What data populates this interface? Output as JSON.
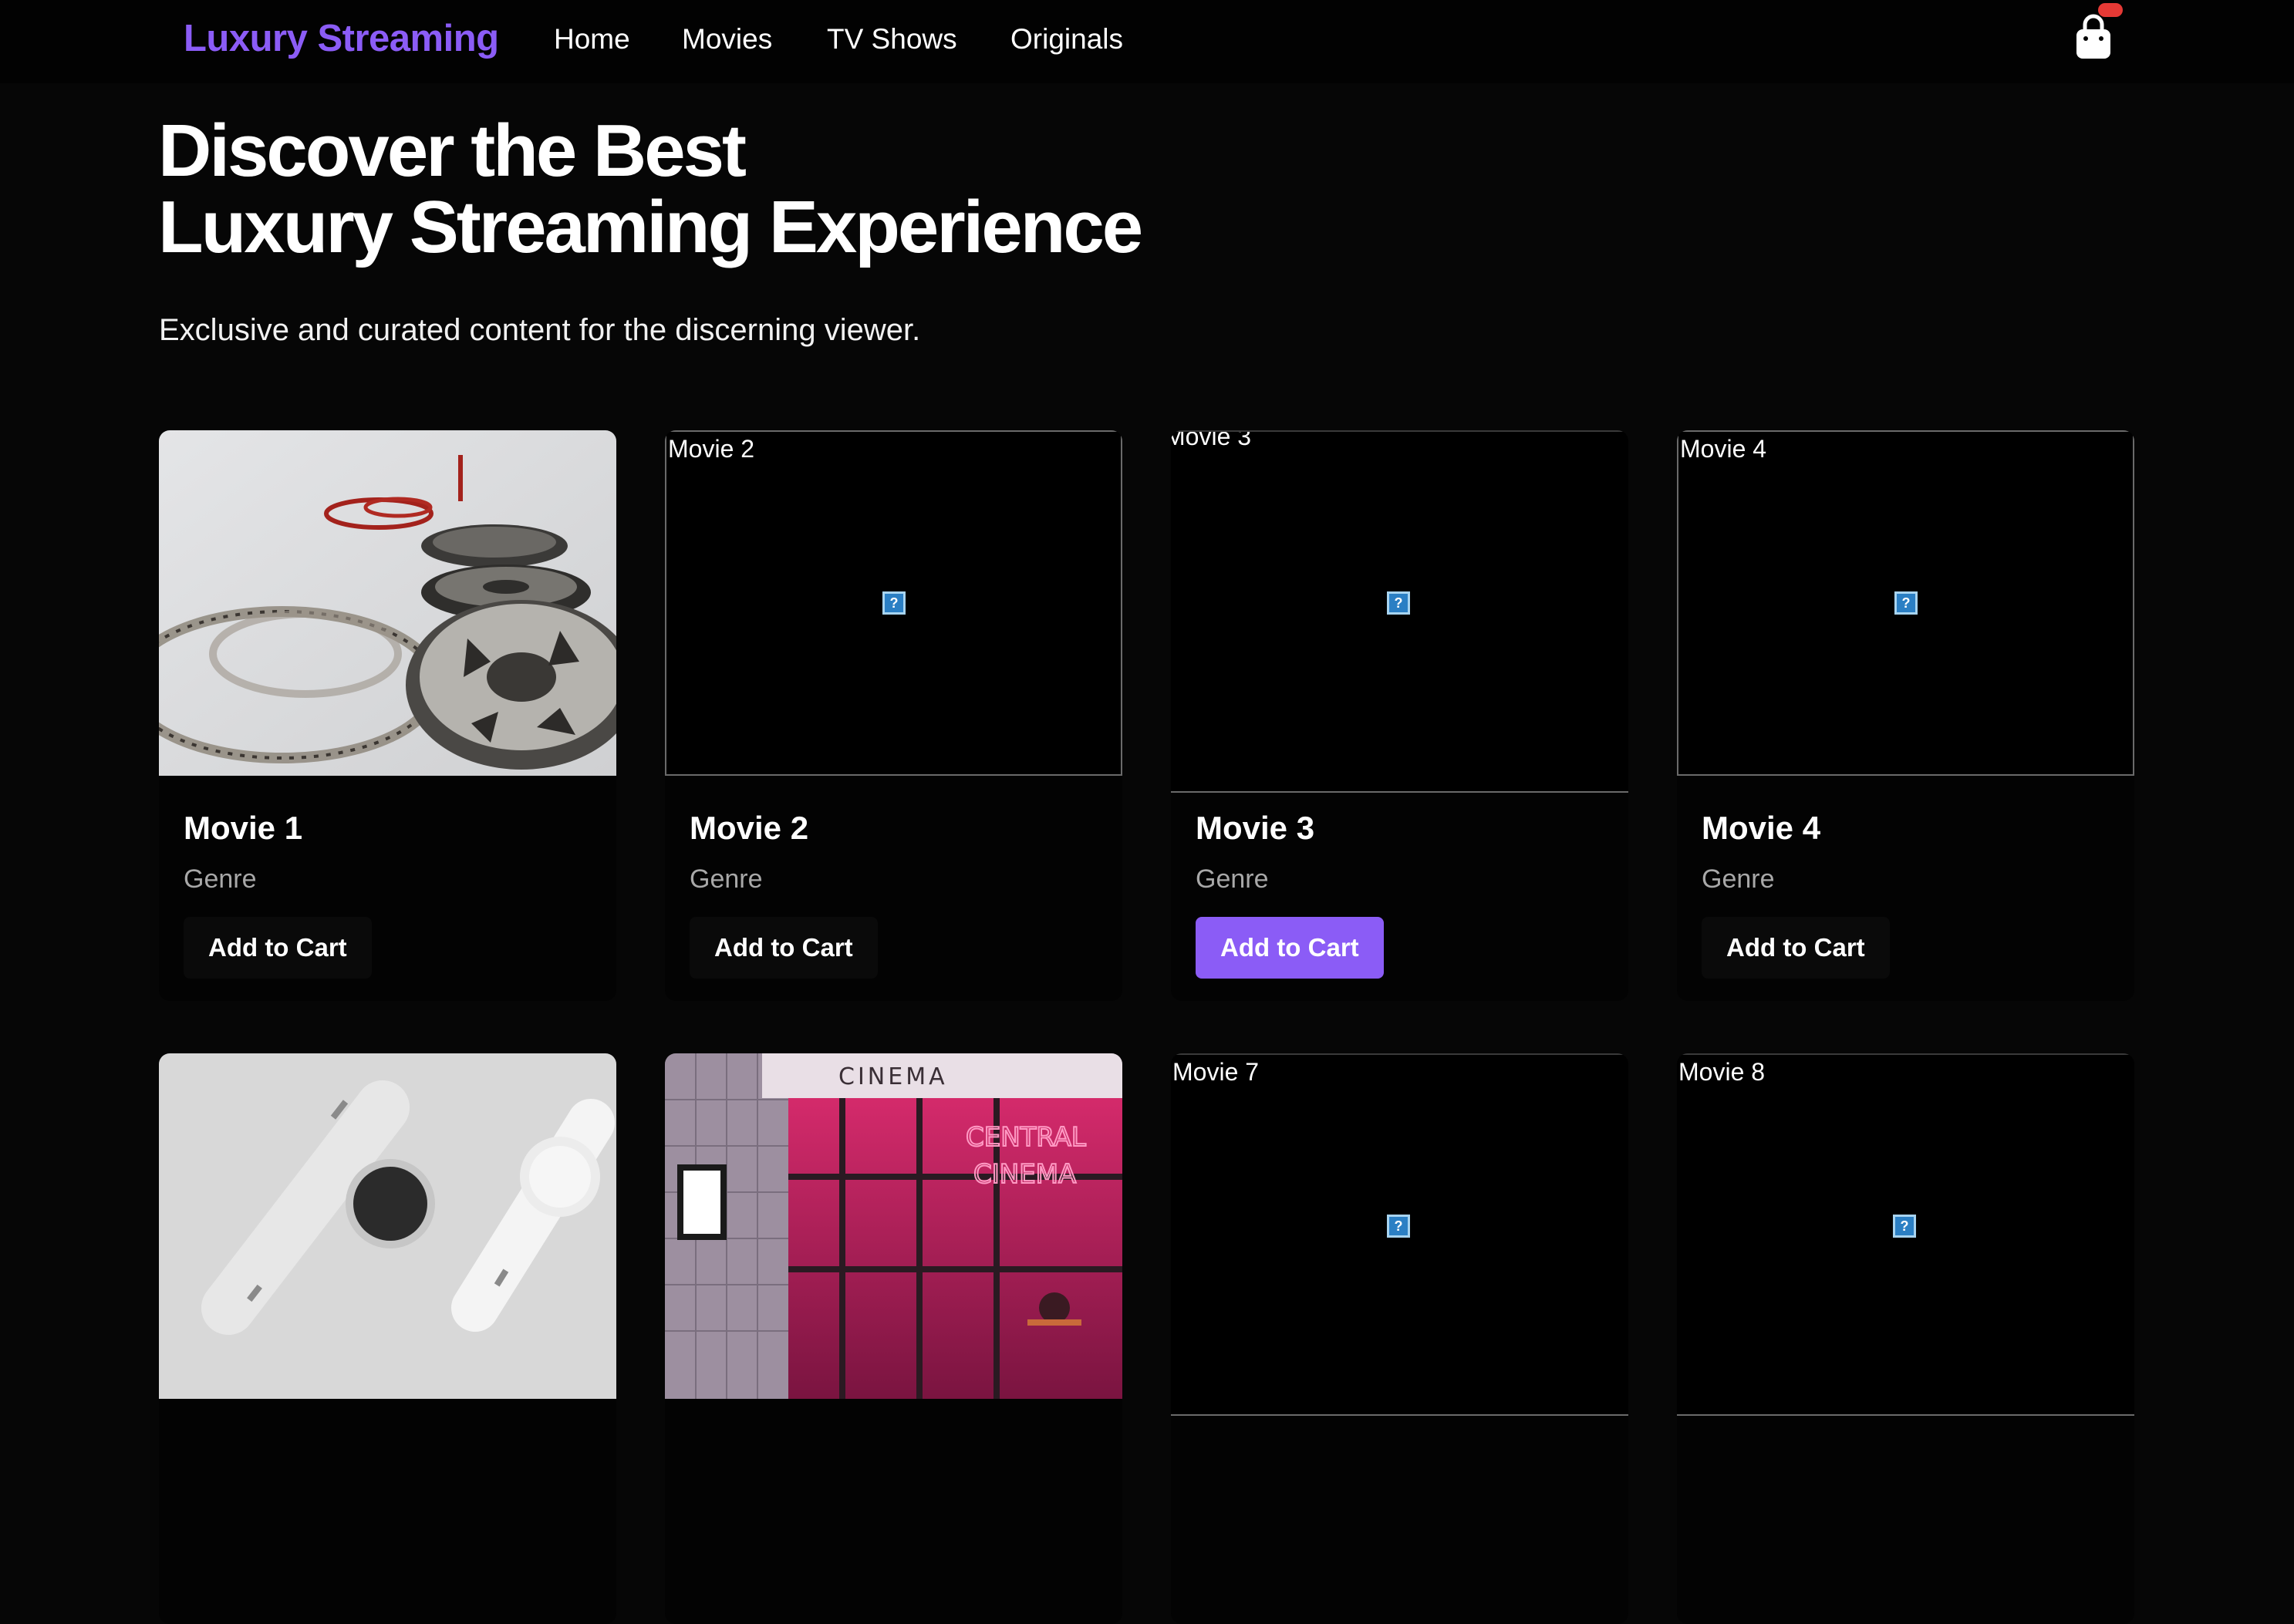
{
  "nav": {
    "brand": "Luxury Streaming",
    "links": [
      "Home",
      "Movies",
      "TV Shows",
      "Originals"
    ],
    "cart_icon": "shopping-bag-icon",
    "badge_color": "#e53935"
  },
  "hero": {
    "title_line1": "Discover the Best",
    "title_line2": "Luxury Streaming Experience",
    "subtitle": "Exclusive and curated content for the discerning viewer."
  },
  "colors": {
    "accent": "#8b5cf6",
    "background": "#060606",
    "genre_text": "#a8a8a8"
  },
  "movies": [
    {
      "title": "Movie 1",
      "genre": "Genre",
      "button": "Add to Cart",
      "image": "film-reels-photo",
      "image_state": "loaded"
    },
    {
      "title": "Movie 2",
      "genre": "Genre",
      "button": "Add to Cart",
      "alt": "Movie 2",
      "image_state": "broken"
    },
    {
      "title": "Movie 3",
      "genre": "Genre",
      "button": "Add to Cart",
      "alt": "Movie 3",
      "image_state": "broken",
      "button_state": "hover"
    },
    {
      "title": "Movie 4",
      "genre": "Genre",
      "button": "Add to Cart",
      "alt": "Movie 4",
      "image_state": "broken"
    },
    {
      "image": "smartwatches-photo",
      "image_state": "loaded"
    },
    {
      "image": "cinema-facade-photo",
      "image_state": "loaded",
      "sign_text": "CINEMA",
      "neon_line1": "CENTRAL",
      "neon_line2": "CINEMA"
    },
    {
      "alt": "Movie 7",
      "image_state": "broken"
    },
    {
      "alt": "Movie 8",
      "image_state": "broken"
    }
  ]
}
